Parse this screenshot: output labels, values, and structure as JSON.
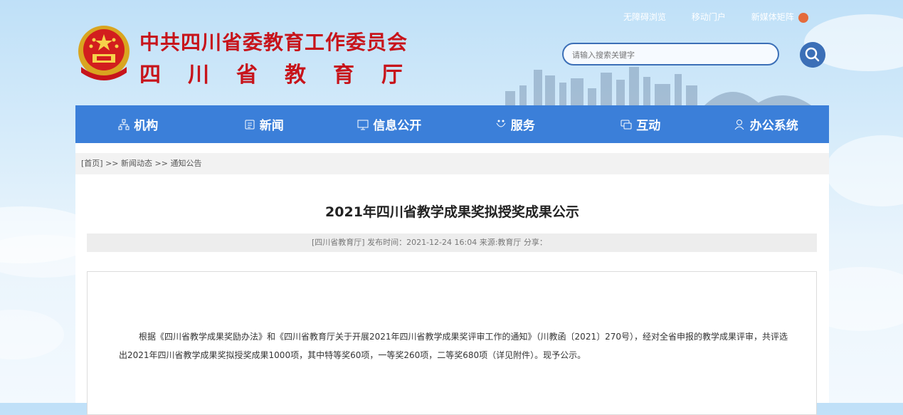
{
  "header": {
    "org_name": "中共四川省委教育工作委员会",
    "dept_name": "四川省教育厅",
    "top_links": [
      "无障碍浏览",
      "移动门户",
      "新媒体矩阵"
    ],
    "search_placeholder": "请输入搜索关键字"
  },
  "nav": [
    {
      "label": "机构",
      "icon": "org-icon"
    },
    {
      "label": "新闻",
      "icon": "news-icon"
    },
    {
      "label": "信息公开",
      "icon": "monitor-icon"
    },
    {
      "label": "服务",
      "icon": "service-icon"
    },
    {
      "label": "互动",
      "icon": "chat-icon"
    },
    {
      "label": "办公系统",
      "icon": "user-icon"
    }
  ],
  "breadcrumb": {
    "home": "[首页]",
    "sep1": ">>",
    "news": "新闻动态",
    "sep2": ">>",
    "current": "通知公告"
  },
  "article": {
    "title": "2021年四川省教学成果奖拟授奖成果公示",
    "meta": "[四川省教育厅]  发布时间：2021-12-24 16:04   来源:教育厅      分享：",
    "body": "根据《四川省教学成果奖励办法》和《四川省教育厅关于开展2021年四川省教学成果奖评审工作的通知》（川教函〔2021〕270号），经对全省申报的教学成果评审，共评选出2021年四川省教学成果奖拟授奖成果1000项，其中特等奖60项，一等奖260项，二等奖680项（详见附件）。现予公示。"
  },
  "share": [
    "share-icon",
    "wechat-icon",
    "weibo-icon"
  ],
  "colors": {
    "brand_red": "#c7141b",
    "nav_blue": "#3b7fd9",
    "search_blue": "#3b6fb7",
    "wechat_green": "#2dbd3b",
    "weibo_red": "#e6584a"
  }
}
